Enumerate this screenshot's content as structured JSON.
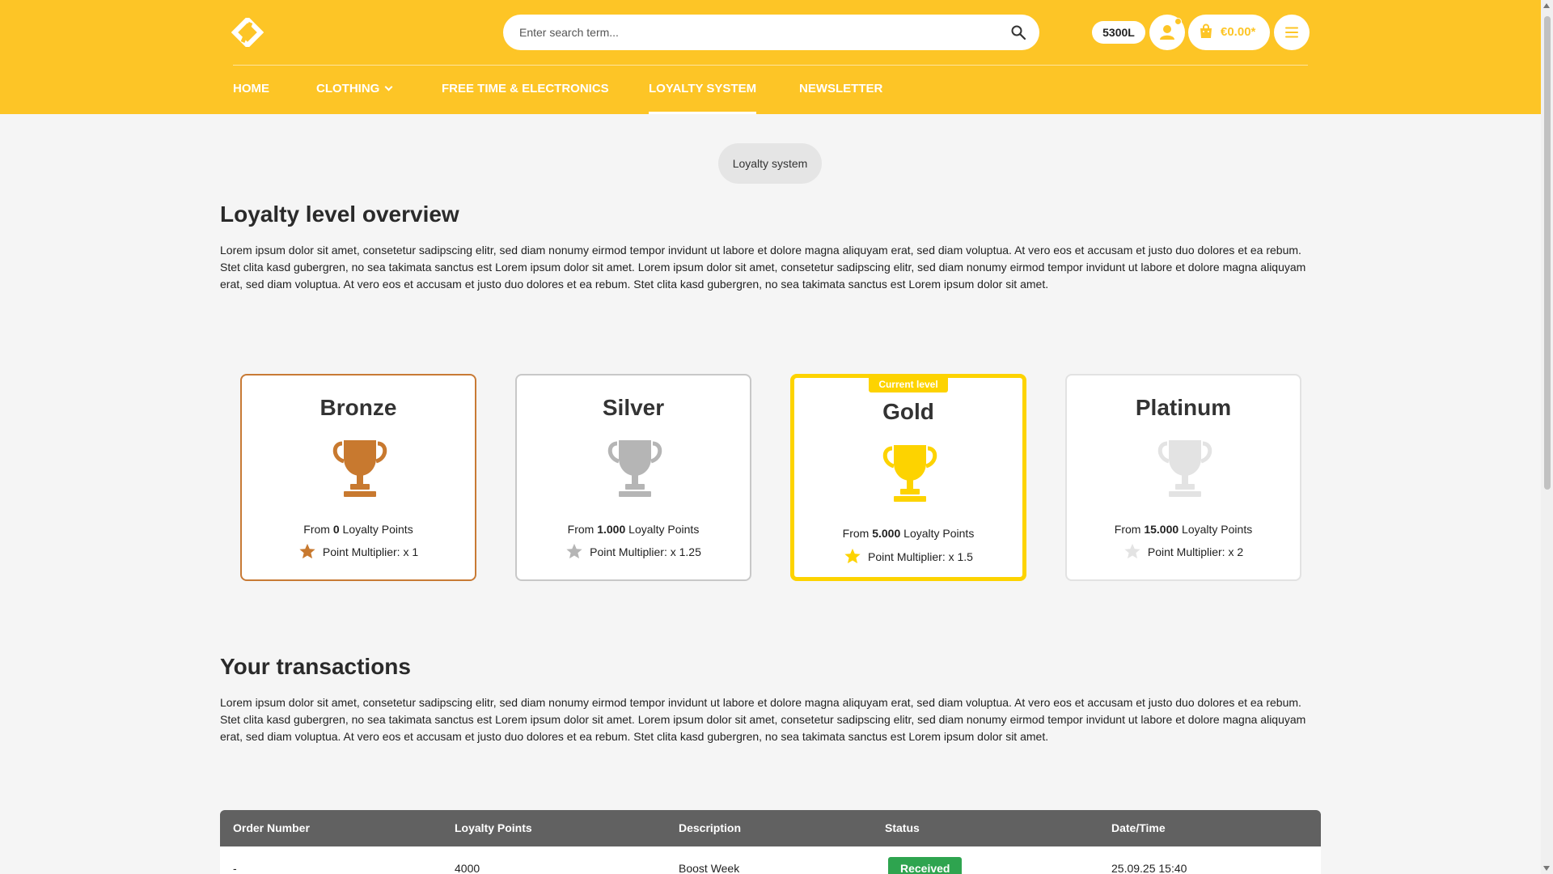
{
  "header": {
    "search_placeholder": "Enter search term...",
    "points_badge": "5300L",
    "cart_amount": "€0.00*",
    "nav": [
      {
        "label": "HOME"
      },
      {
        "label": "CLOTHING"
      },
      {
        "label": "FREE TIME & ELECTRONICS"
      },
      {
        "label": "LOYALTY SYSTEM",
        "active": true
      },
      {
        "label": "NEWSLETTER"
      }
    ]
  },
  "breadcrumb": "Loyalty system",
  "overview": {
    "title": "Loyalty level overview",
    "text": "Lorem ipsum dolor sit amet, consetetur sadipscing elitr, sed diam nonumy eirmod tempor invidunt ut labore et dolore magna aliquyam erat, sed diam voluptua. At vero eos et accusam et justo duo dolores et ea rebum. Stet clita kasd gubergren, no sea takimata sanctus est Lorem ipsum dolor sit amet. Lorem ipsum dolor sit amet, consetetur sadipscing elitr, sed diam nonumy eirmod tempor invidunt ut labore et dolore magna aliquyam erat, sed diam voluptua. At vero eos et accusam et justo duo dolores et ea rebum. Stet clita kasd gubergren, no sea takimata sanctus est Lorem ipsum dolor sit amet."
  },
  "levels": [
    {
      "name": "Bronze",
      "from_prefix": "From ",
      "points": "0",
      "from_suffix": " Loyalty Points",
      "multiplier": "Point Multiplier: x 1",
      "color": "#c8792f"
    },
    {
      "name": "Silver",
      "from_prefix": "From ",
      "points": "1.000",
      "from_suffix": " Loyalty Points",
      "multiplier": "Point Multiplier: x 1.25",
      "color": "#b5b5b5"
    },
    {
      "name": "Gold",
      "from_prefix": "From ",
      "points": "5.000",
      "from_suffix": " Loyalty Points",
      "multiplier": "Point Multiplier: x 1.5",
      "color": "#fdd300",
      "badge": "Current level"
    },
    {
      "name": "Platinum",
      "from_prefix": "From ",
      "points": "15.000",
      "from_suffix": " Loyalty Points",
      "multiplier": "Point Multiplier: x 2",
      "color": "#e3e3e3"
    }
  ],
  "transactions": {
    "title": "Your transactions",
    "text": "Lorem ipsum dolor sit amet, consetetur sadipscing elitr, sed diam nonumy eirmod tempor invidunt ut labore et dolore magna aliquyam erat, sed diam voluptua. At vero eos et accusam et justo duo dolores et ea rebum. Stet clita kasd gubergren, no sea takimata sanctus est Lorem ipsum dolor sit amet. Lorem ipsum dolor sit amet, consetetur sadipscing elitr, sed diam nonumy eirmod tempor invidunt ut labore et dolore magna aliquyam erat, sed diam voluptua. At vero eos et accusam et justo duo dolores et ea rebum. Stet clita kasd gubergren, no sea takimata sanctus est Lorem ipsum dolor sit amet.",
    "columns": [
      "Order Number",
      "Loyalty Points",
      "Description",
      "Status",
      "Date/Time"
    ],
    "rows": [
      {
        "order": "-",
        "points": "4000",
        "description": "Boost Week",
        "status": "Received",
        "datetime": "25.09.25 15:40"
      }
    ]
  },
  "colors": {
    "brand": "#fdc526",
    "gold": "#fdd300",
    "status_received": "#2ea44f"
  },
  "icons": [
    "logo-icon",
    "search-icon",
    "user-icon",
    "shopping-bag-icon",
    "hamburger-menu-icon",
    "trophy-icon",
    "star-icon",
    "chevron-down-icon"
  ]
}
